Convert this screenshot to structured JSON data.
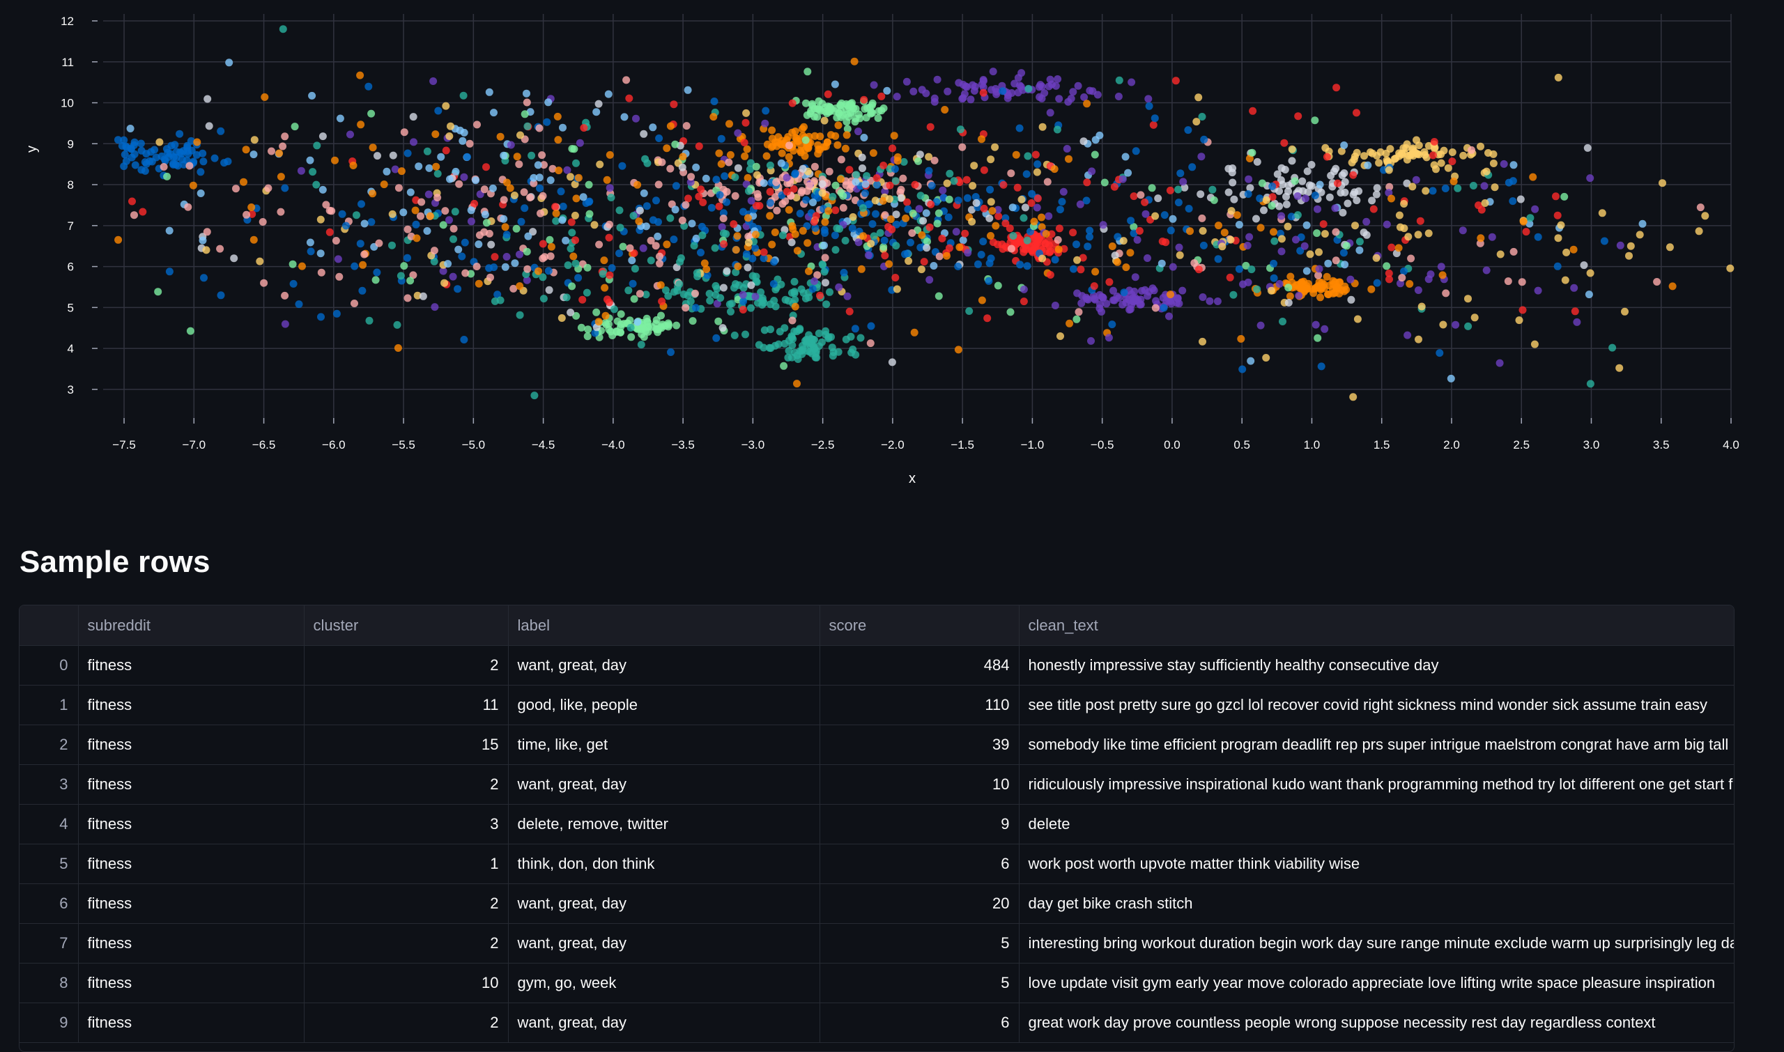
{
  "chart": {
    "xlabel": "x",
    "ylabel": "y",
    "xticks": [
      "−7.5",
      "−7.0",
      "−6.5",
      "−6.0",
      "−5.5",
      "−5.0",
      "−4.5",
      "−4.0",
      "−3.5",
      "−3.0",
      "−2.5",
      "−2.0",
      "−1.5",
      "−1.0",
      "−0.5",
      "0.0",
      "0.5",
      "1.0",
      "1.5",
      "2.0",
      "2.5",
      "3.0",
      "3.5",
      "4.0"
    ],
    "yticks": [
      "3",
      "4",
      "5",
      "6",
      "7",
      "8",
      "9",
      "10",
      "11",
      "12"
    ],
    "colors": {
      "background": "#0e1117",
      "grid": "#31333f",
      "palette": [
        "#0068c9",
        "#83c9ff",
        "#ff2b2b",
        "#ffabab",
        "#29b09d",
        "#7defa1",
        "#ff8700",
        "#ffd16a",
        "#6d3fc0",
        "#d5dae5"
      ]
    }
  },
  "chart_data": {
    "type": "scatter",
    "xlabel": "x",
    "ylabel": "y",
    "xlim": [
      -7.6,
      4.0
    ],
    "ylim": [
      2.3,
      12.0
    ],
    "grid": true,
    "legend": "none",
    "clusters": [
      {
        "center": [
          -2.4,
          9.8
        ],
        "spread": [
          0.15,
          0.15
        ],
        "color": "#7defa1"
      },
      {
        "center": [
          -1.2,
          10.3
        ],
        "spread": [
          0.35,
          0.15
        ],
        "color": "#6d3fc0"
      },
      {
        "center": [
          -1.0,
          6.55
        ],
        "spread": [
          0.15,
          0.15
        ],
        "color": "#ff2b2b"
      },
      {
        "center": [
          1.05,
          5.5
        ],
        "spread": [
          0.15,
          0.1
        ],
        "color": "#ff8700"
      },
      {
        "center": [
          -3.1,
          5.3
        ],
        "spread": [
          0.3,
          0.2
        ],
        "color": "#29b09d"
      },
      {
        "center": [
          -3.8,
          4.5
        ],
        "spread": [
          0.2,
          0.12
        ],
        "color": "#7defa1"
      },
      {
        "center": [
          -2.6,
          4.1
        ],
        "spread": [
          0.15,
          0.2
        ],
        "color": "#29b09d"
      },
      {
        "center": [
          -2.7,
          9.0
        ],
        "spread": [
          0.2,
          0.15
        ],
        "color": "#ff8700"
      },
      {
        "center": [
          -2.6,
          8.0
        ],
        "spread": [
          0.5,
          0.3
        ],
        "color": "#ffabab"
      },
      {
        "center": [
          -2.1,
          7.1
        ],
        "spread": [
          0.7,
          0.6
        ],
        "color": "#0068c9"
      },
      {
        "center": [
          -0.3,
          5.2
        ],
        "spread": [
          0.2,
          0.12
        ],
        "color": "#6d3fc0"
      },
      {
        "center": [
          1.7,
          8.7
        ],
        "spread": [
          0.25,
          0.15
        ],
        "color": "#ffd16a"
      },
      {
        "center": [
          0.9,
          8.0
        ],
        "spread": [
          0.3,
          0.3
        ],
        "color": "#d5dae5"
      },
      {
        "center": [
          -7.2,
          8.7
        ],
        "spread": [
          0.25,
          0.2
        ],
        "color": "#0068c9"
      },
      {
        "center": [
          -4.5,
          6.5
        ],
        "spread": [
          1.2,
          1.2
        ],
        "color": "#0068c9"
      },
      {
        "center": [
          -3.5,
          6.0
        ],
        "spread": [
          1.0,
          1.0
        ],
        "color": "#29b09d"
      },
      {
        "center": [
          -0.2,
          7.0
        ],
        "spread": [
          1.5,
          1.2
        ],
        "color": "#0068c9"
      },
      {
        "center": [
          -5.5,
          7.5
        ],
        "spread": [
          1.2,
          1.2
        ],
        "color": "#ffabab"
      },
      {
        "center": [
          -1.5,
          8.0
        ],
        "spread": [
          1.5,
          1.3
        ],
        "color": "#ff2b2b"
      },
      {
        "center": [
          -5.0,
          8.5
        ],
        "spread": [
          1.3,
          1.0
        ],
        "color": "#83c9ff"
      },
      {
        "center": [
          0.5,
          6.5
        ],
        "spread": [
          1.4,
          1.2
        ],
        "color": "#6d3fc0"
      },
      {
        "center": [
          -3.0,
          7.5
        ],
        "spread": [
          1.5,
          1.5
        ],
        "color": "#ff8700"
      },
      {
        "center": [
          1.8,
          6.5
        ],
        "spread": [
          1.2,
          1.5
        ],
        "color": "#ffd16a"
      }
    ]
  },
  "section": {
    "title": "Sample rows"
  },
  "table": {
    "headers": [
      "",
      "subreddit",
      "cluster",
      "label",
      "score",
      "clean_text"
    ],
    "rows": [
      {
        "index": "0",
        "subreddit": "fitness",
        "cluster": "2",
        "label": "want, great, day",
        "score": "484",
        "clean_text": "honestly impressive stay sufficiently healthy consecutive day"
      },
      {
        "index": "1",
        "subreddit": "fitness",
        "cluster": "11",
        "label": "good, like, people",
        "score": "110",
        "clean_text": "see title post pretty sure go gzcl lol recover covid right sickness mind wonder sick assume train easy"
      },
      {
        "index": "2",
        "subreddit": "fitness",
        "cluster": "15",
        "label": "time, like, get",
        "score": "39",
        "clean_text": "somebody like time efficient program deadlift rep prs super intrigue maelstrom congrat have arm big tall"
      },
      {
        "index": "3",
        "subreddit": "fitness",
        "cluster": "2",
        "label": "want, great, day",
        "score": "10",
        "clean_text": "ridiculously impressive inspirational kudo want thank programming method try lot different one get start f"
      },
      {
        "index": "4",
        "subreddit": "fitness",
        "cluster": "3",
        "label": "delete, remove, twitter",
        "score": "9",
        "clean_text": "delete"
      },
      {
        "index": "5",
        "subreddit": "fitness",
        "cluster": "1",
        "label": "think, don, don think",
        "score": "6",
        "clean_text": "work post worth upvote matter think viability wise"
      },
      {
        "index": "6",
        "subreddit": "fitness",
        "cluster": "2",
        "label": "want, great, day",
        "score": "20",
        "clean_text": "day get bike crash stitch"
      },
      {
        "index": "7",
        "subreddit": "fitness",
        "cluster": "2",
        "label": "want, great, day",
        "score": "5",
        "clean_text": "interesting bring workout duration begin work day sure range minute exclude warm up surprisingly leg day"
      },
      {
        "index": "8",
        "subreddit": "fitness",
        "cluster": "10",
        "label": "gym, go, week",
        "score": "5",
        "clean_text": "love update visit gym early year move colorado appreciate love lifting write space pleasure inspiration"
      },
      {
        "index": "9",
        "subreddit": "fitness",
        "cluster": "2",
        "label": "want, great, day",
        "score": "6",
        "clean_text": "great work day prove countless people wrong suppose necessity rest day regardless context"
      }
    ]
  }
}
